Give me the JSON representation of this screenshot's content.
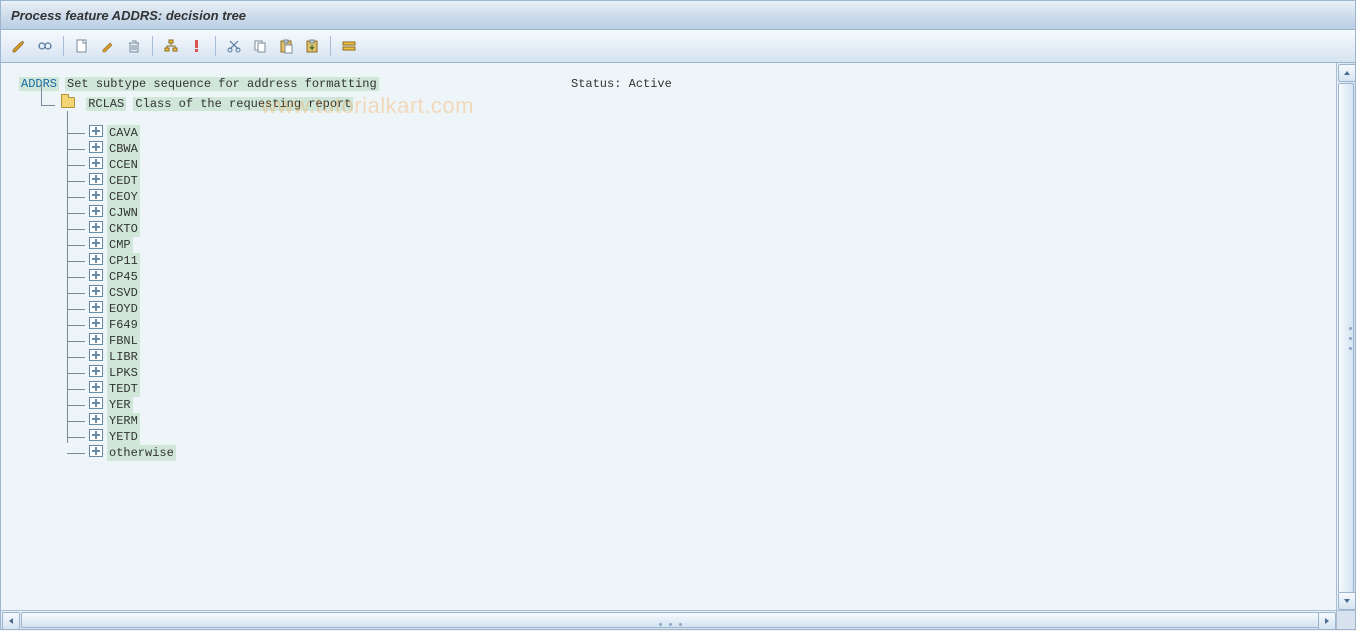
{
  "title": "Process feature ADDRS: decision tree",
  "toolbar": {
    "icons": [
      "pencil-ruler",
      "glasses",
      "new-doc",
      "edit-doc",
      "delete",
      "hierarchy",
      "error-check",
      "cut",
      "copy",
      "paste-clip",
      "paste-below",
      "collapse-all"
    ]
  },
  "watermark": "www.tutorialkart.com",
  "feature": {
    "code": "ADDRS",
    "desc": "Set subtype sequence for address formatting",
    "status_label": "Status:",
    "status_value": "Active"
  },
  "rclas": {
    "code": "RCLAS",
    "desc": "Class of the requesting report"
  },
  "children": [
    "CAVA",
    "CBWA",
    "CCEN",
    "CEDT",
    "CEOY",
    "CJWN",
    "CKTO",
    "CMP",
    "CP11",
    "CP45",
    "CSVD",
    "EOYD",
    "F649",
    "FBNL",
    "LIBR",
    "LPKS",
    "TEDT",
    "YER",
    "YERM",
    "YETD",
    "otherwise"
  ]
}
